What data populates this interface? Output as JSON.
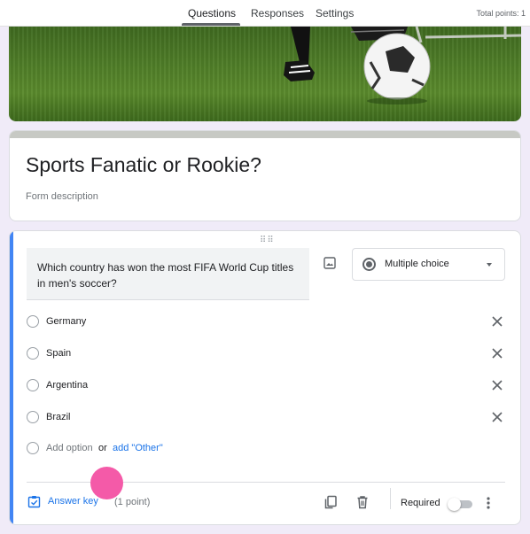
{
  "tabs": [
    {
      "label": "Questions",
      "active": true
    },
    {
      "label": "Responses",
      "active": false
    },
    {
      "label": "Settings",
      "active": false
    }
  ],
  "total_points": "Total points: 1",
  "form": {
    "title": "Sports Fanatic or Rookie?",
    "description": "Form description"
  },
  "question": {
    "text": "Which country has won the most FIFA World Cup titles in men's soccer?",
    "type": "Multiple choice",
    "options": [
      "Germany",
      "Spain",
      "Argentina",
      "Brazil"
    ],
    "add_option": "Add option",
    "or": "or",
    "add_other": "add \"Other\"",
    "answer_key": "Answer key",
    "points": "(1 point)",
    "required_label": "Required",
    "required": false
  },
  "colors": {
    "accent": "#4285f4",
    "link": "#1a73e8",
    "cursor_dot": "#f45aa8"
  }
}
